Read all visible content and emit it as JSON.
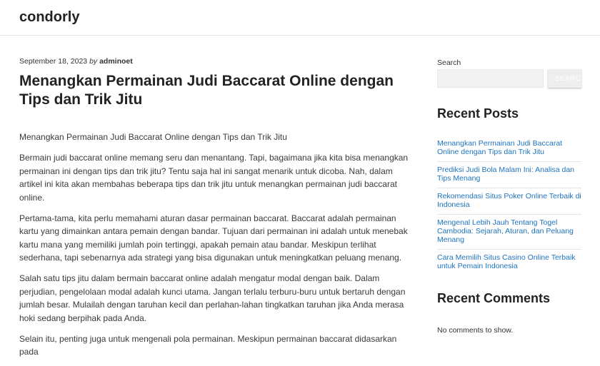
{
  "site": {
    "title": "condorly"
  },
  "post": {
    "date": "September 18, 2023",
    "by": "by",
    "author": "adminoet",
    "title": "Menangkan Permainan Judi Baccarat Online dengan Tips dan Trik Jitu",
    "paragraphs": [
      "Menangkan Permainan Judi Baccarat Online dengan Tips dan Trik Jitu",
      "Bermain judi baccarat online memang seru dan menantang. Tapi, bagaimana jika kita bisa menangkan permainan ini dengan tips dan trik jitu? Tentu saja hal ini sangat menarik untuk dicoba. Nah, dalam artikel ini kita akan membahas beberapa tips dan trik jitu untuk menangkan permainan judi baccarat online.",
      "Pertama-tama, kita perlu memahami aturan dasar permainan baccarat. Baccarat adalah permainan kartu yang dimainkan antara pemain dengan bandar. Tujuan dari permainan ini adalah untuk menebak kartu mana yang memiliki jumlah poin tertinggi, apakah pemain atau bandar. Meskipun terlihat sederhana, tapi sebenarnya ada strategi yang bisa digunakan untuk meningkatkan peluang menang.",
      "Salah satu tips jitu dalam bermain baccarat online adalah mengatur modal dengan baik. Dalam perjudian, pengelolaan modal adalah kunci utama. Jangan terlalu terburu-buru untuk bertaruh dengan jumlah besar. Mulailah dengan taruhan kecil dan perlahan-lahan tingkatkan taruhan jika Anda merasa hoki sedang berpihak pada Anda.",
      "Selain itu, penting juga untuk mengenali pola permainan. Meskipun permainan baccarat didasarkan pada"
    ]
  },
  "sidebar": {
    "search_label": "Search",
    "search_placeholder": "",
    "search_button": "SEARCH",
    "recent_posts_title": "Recent Posts",
    "recent_posts": [
      "Menangkan Permainan Judi Baccarat Online dengan Tips dan Trik Jitu",
      "Prediksi Judi Bola Malam Ini: Analisa dan Tips Menang",
      "Rekomendasi Situs Poker Online Terbaik di Indonesia",
      "Mengenal Lebih Jauh Tentang Togel Cambodia: Sejarah, Aturan, dan Peluang Menang",
      "Cara Memilih Situs Casino Online Terbaik untuk Pemain Indonesia"
    ],
    "recent_comments_title": "Recent Comments",
    "no_comments": "No comments to show."
  },
  "colors": {
    "link": "#1e73be"
  }
}
